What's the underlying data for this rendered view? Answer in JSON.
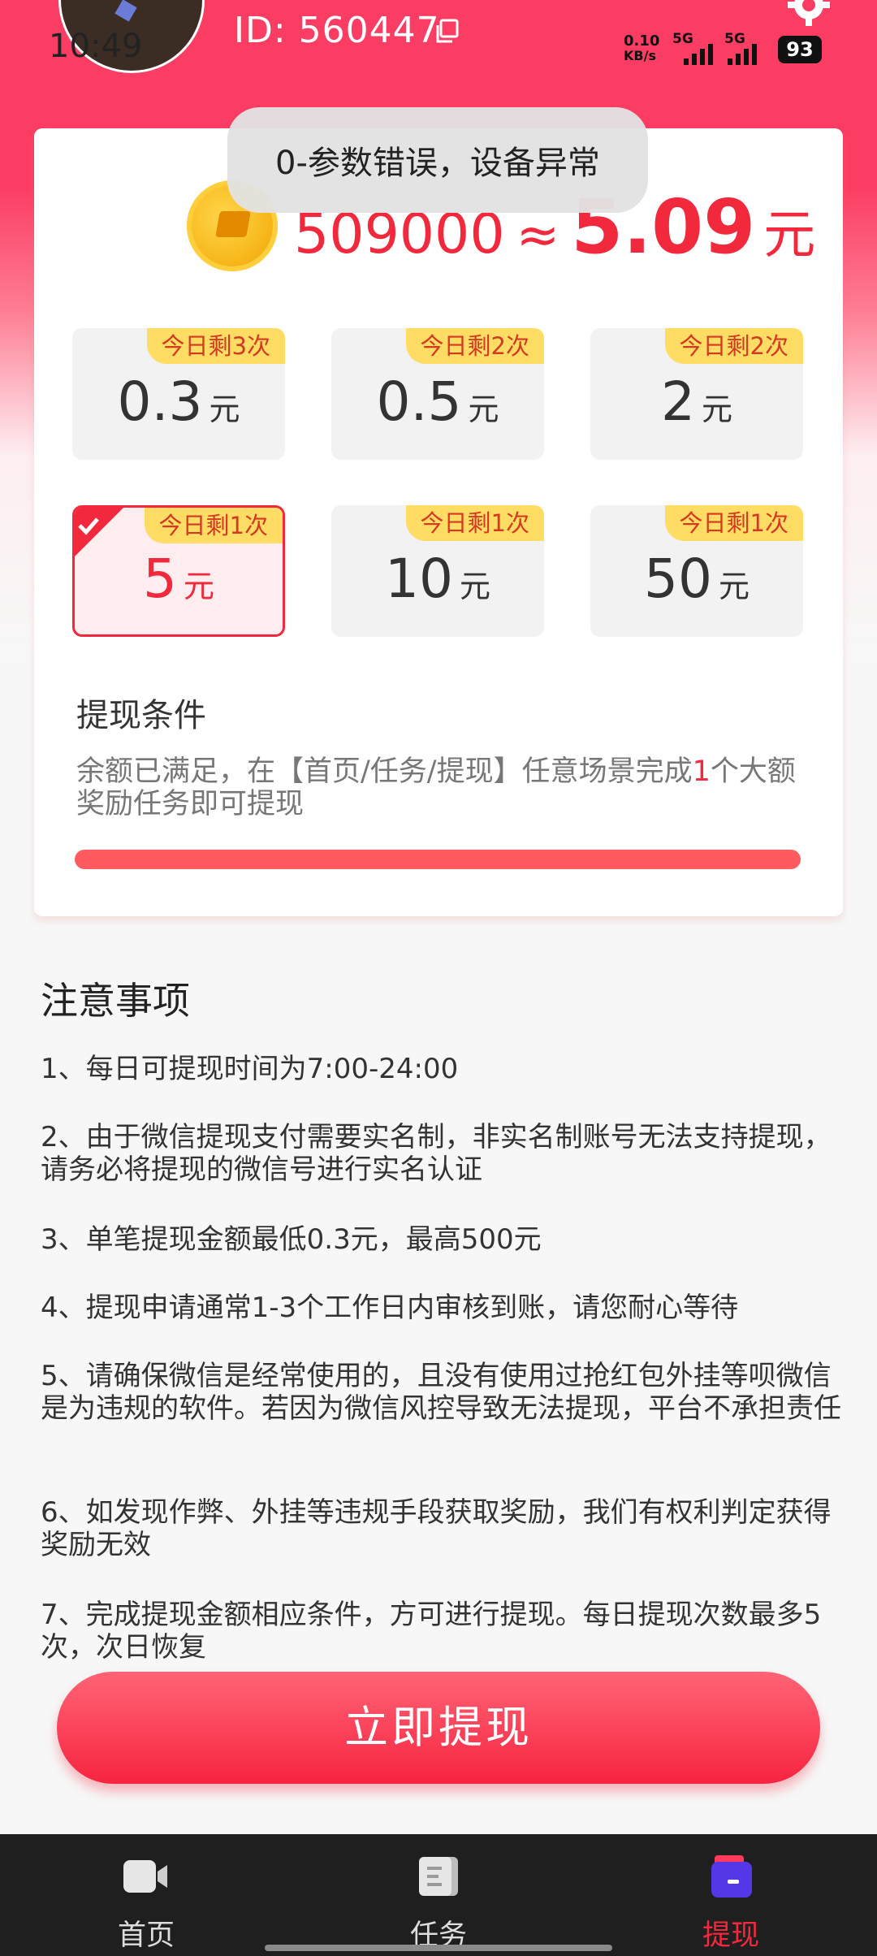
{
  "status_bar": {
    "time": "10:49",
    "net_speed_value": "0.10",
    "net_speed_unit": "KB/s",
    "signal1": "5G",
    "signal2": "5G",
    "battery": "93"
  },
  "header": {
    "user_id": "ID: 560447"
  },
  "toast": {
    "message": "0-参数错误，设备异常"
  },
  "balance": {
    "coins": "509000",
    "approx": "≈",
    "money": "5.09",
    "unit": "元"
  },
  "options": [
    {
      "badge": "今日剩3次",
      "amount": "0.3",
      "unit": "元",
      "selected": false
    },
    {
      "badge": "今日剩2次",
      "amount": "0.5",
      "unit": "元",
      "selected": false
    },
    {
      "badge": "今日剩2次",
      "amount": "2",
      "unit": "元",
      "selected": false
    },
    {
      "badge": "今日剩1次",
      "amount": "5",
      "unit": "元",
      "selected": true
    },
    {
      "badge": "今日剩1次",
      "amount": "10",
      "unit": "元",
      "selected": false
    },
    {
      "badge": "今日剩1次",
      "amount": "50",
      "unit": "元",
      "selected": false
    }
  ],
  "condition": {
    "title": "提现条件",
    "text_before": "余额已满足，在【首页/任务/提现】任意场景完成",
    "highlight": "1",
    "text_after": "个大额奖励任务即可提现",
    "progress": 1.0
  },
  "notes": {
    "title": "注意事项",
    "items": [
      "1、每日可提现时间为7:00-24:00",
      "2、由于微信提现支付需要实名制，非实名制账号无法支持提现，请务必将提现的微信号进行实名认证",
      "3、单笔提现金额最低0.3元，最高500元",
      "4、提现申请通常1-3个工作日内审核到账，请您耐心等待",
      "5、请确保微信是经常使用的，且没有使用过抢红包外挂等呗微信是为违规的软件。若因为微信风控导致无法提现，平台不承担责任",
      "6、如发现作弊、外挂等违规手段获取奖励，我们有权利判定获得奖励无效",
      "7、完成提现金额相应条件，方可进行提现。每日提现次数最多5次，次日恢复"
    ]
  },
  "withdraw_button": "立即提现",
  "nav": {
    "items": [
      {
        "label": "首页",
        "icon": "video-camera-icon"
      },
      {
        "label": "任务",
        "icon": "task-list-icon"
      },
      {
        "label": "提现",
        "icon": "wallet-icon",
        "active": true
      }
    ]
  },
  "colors": {
    "accent": "#f2283c",
    "header": "#fb3d63",
    "badge": "#ffdc64"
  }
}
